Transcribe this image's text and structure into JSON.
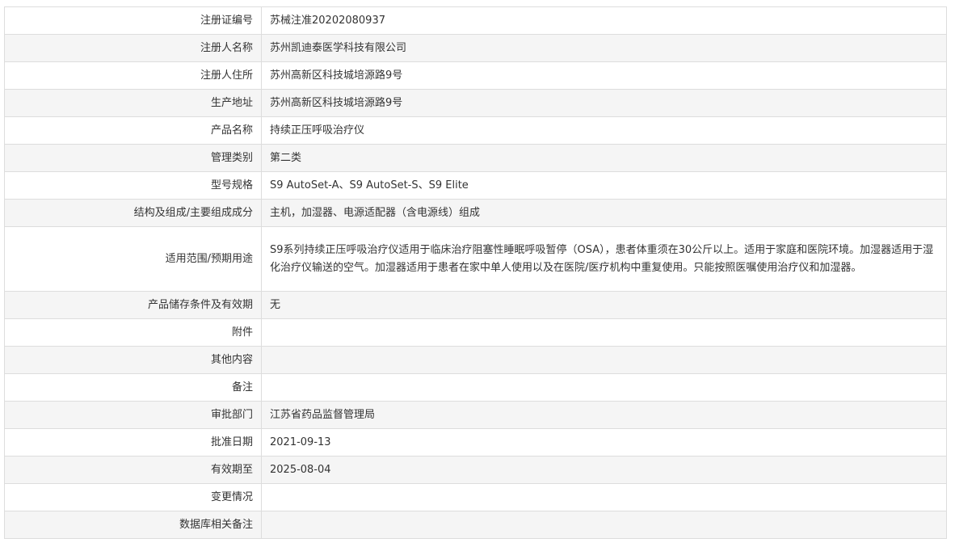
{
  "rows": [
    {
      "label": "注册证编号",
      "value": "苏械注准20202080937"
    },
    {
      "label": "注册人名称",
      "value": "苏州凯迪泰医学科技有限公司"
    },
    {
      "label": "注册人住所",
      "value": "苏州高新区科技城培源路9号"
    },
    {
      "label": "生产地址",
      "value": "苏州高新区科技城培源路9号"
    },
    {
      "label": "产品名称",
      "value": "持续正压呼吸治疗仪"
    },
    {
      "label": "管理类别",
      "value": "第二类"
    },
    {
      "label": "型号规格",
      "value": "S9 AutoSet-A、S9 AutoSet-S、S9 Elite"
    },
    {
      "label": "结构及组成/主要组成成分",
      "value": "主机，加湿器、电源适配器（含电源线）组成"
    },
    {
      "label": "适用范围/预期用途",
      "value": "S9系列持续正压呼吸治疗仪适用于临床治疗阻塞性睡眠呼吸暂停（OSA），患者体重须在30公斤以上。适用于家庭和医院环境。加湿器适用于湿化治疗仪输送的空气。加湿器适用于患者在家中单人使用以及在医院/医疗机构中重复使用。只能按照医嘱使用治疗仪和加湿器。"
    },
    {
      "label": "产品储存条件及有效期",
      "value": "无"
    },
    {
      "label": "附件",
      "value": ""
    },
    {
      "label": "其他内容",
      "value": ""
    },
    {
      "label": "备注",
      "value": ""
    },
    {
      "label": "审批部门",
      "value": "江苏省药品监督管理局"
    },
    {
      "label": "批准日期",
      "value": "2021-09-13"
    },
    {
      "label": "有效期至",
      "value": "2025-08-04"
    },
    {
      "label": "变更情况",
      "value": ""
    },
    {
      "label": "数据库相关备注",
      "value": ""
    }
  ]
}
